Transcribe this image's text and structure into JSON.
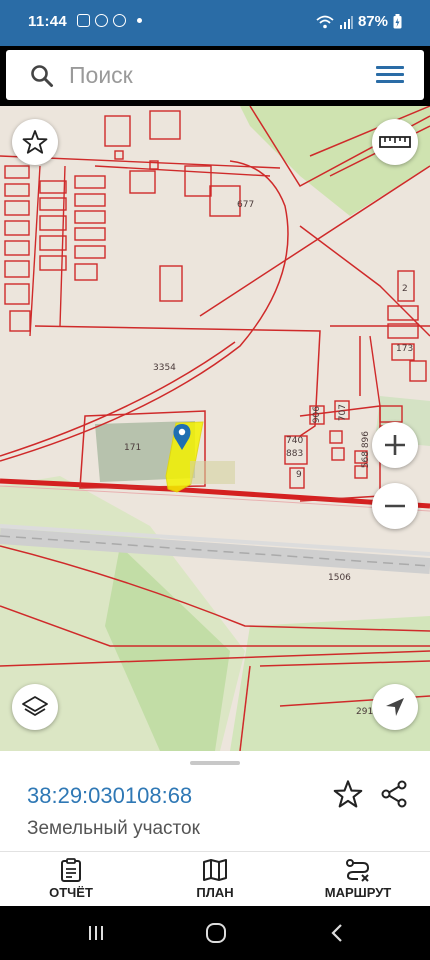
{
  "status_bar": {
    "time": "11:44",
    "battery": "87%"
  },
  "search": {
    "placeholder": "Поиск"
  },
  "map": {
    "labels": {
      "l677": "677",
      "l3354": "3354",
      "l171": "171",
      "l906": "906",
      "l707": "707",
      "l740": "740",
      "l883": "883",
      "l9": "9",
      "l568": "568 896",
      "l173": "173",
      "l2": "2",
      "l1506": "1506",
      "l291": "291"
    },
    "colors": {
      "boundary": "#cf2a2a",
      "selected_parcel": "#f4f200",
      "marker": "#1f6fb2"
    }
  },
  "parcel": {
    "cadastral_number": "38:29:030108:68",
    "type": "Земельный участок"
  },
  "tabs": {
    "report": "ОТЧЁТ",
    "plan": "ПЛАН",
    "route": "МАРШРУТ"
  }
}
